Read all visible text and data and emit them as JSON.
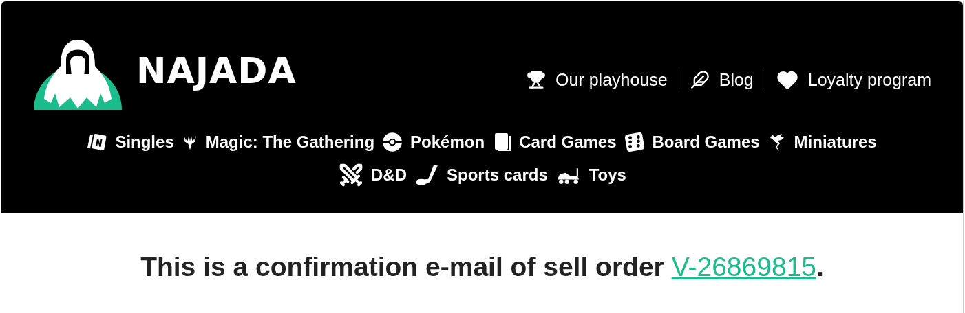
{
  "header": {
    "brand": "NAJADA",
    "top_links": [
      {
        "label": "Our playhouse"
      },
      {
        "label": "Blog"
      },
      {
        "label": "Loyalty program"
      }
    ],
    "category_rows": [
      [
        {
          "label": "Singles"
        },
        {
          "label": "Magic: The Gathering"
        },
        {
          "label": "Pokémon"
        },
        {
          "label": "Card Games"
        },
        {
          "label": "Board Games"
        },
        {
          "label": "Miniatures"
        }
      ],
      [
        {
          "label": "D&D"
        },
        {
          "label": "Sports cards"
        },
        {
          "label": "Toys"
        }
      ]
    ]
  },
  "message": {
    "text": "This is a confirmation e-mail of sell order ",
    "order_link": "V-26869815",
    "end": "."
  }
}
